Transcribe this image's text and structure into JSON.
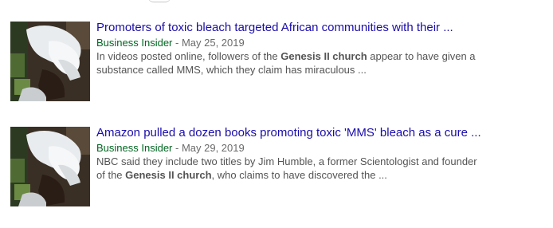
{
  "results": [
    {
      "title": "Promoters of toxic bleach targeted African communities with their ...",
      "source": "Business Insider",
      "separator": " - ",
      "date": "May 25, 2019",
      "snippet_line1_pre": "In videos posted online, followers of the ",
      "snippet_line1_bold": "Genesis II church",
      "snippet_line1_post": " appear to have given a",
      "snippet_line2_pre": "substance called MMS, which they claim has miraculous ...",
      "snippet_line2_bold": "",
      "snippet_line2_post": "",
      "thumbnail_icon": "news-thumbnail-image"
    },
    {
      "title": "Amazon pulled a dozen books promoting toxic 'MMS' bleach as a cure ...",
      "source": "Business Insider",
      "separator": " - ",
      "date": "May 29, 2019",
      "snippet_line1_pre": "NBC said they include two titles by Jim Humble, a former Scientologist and founder",
      "snippet_line1_bold": "",
      "snippet_line1_post": "",
      "snippet_line2_pre": "of the ",
      "snippet_line2_bold": "Genesis II church",
      "snippet_line2_post": ", who claims to have discovered the ...",
      "thumbnail_icon": "news-thumbnail-image"
    }
  ],
  "colors": {
    "title_link": "#1a0dab",
    "source": "#006621",
    "meta": "#6a6a6a",
    "snippet": "#545454"
  }
}
